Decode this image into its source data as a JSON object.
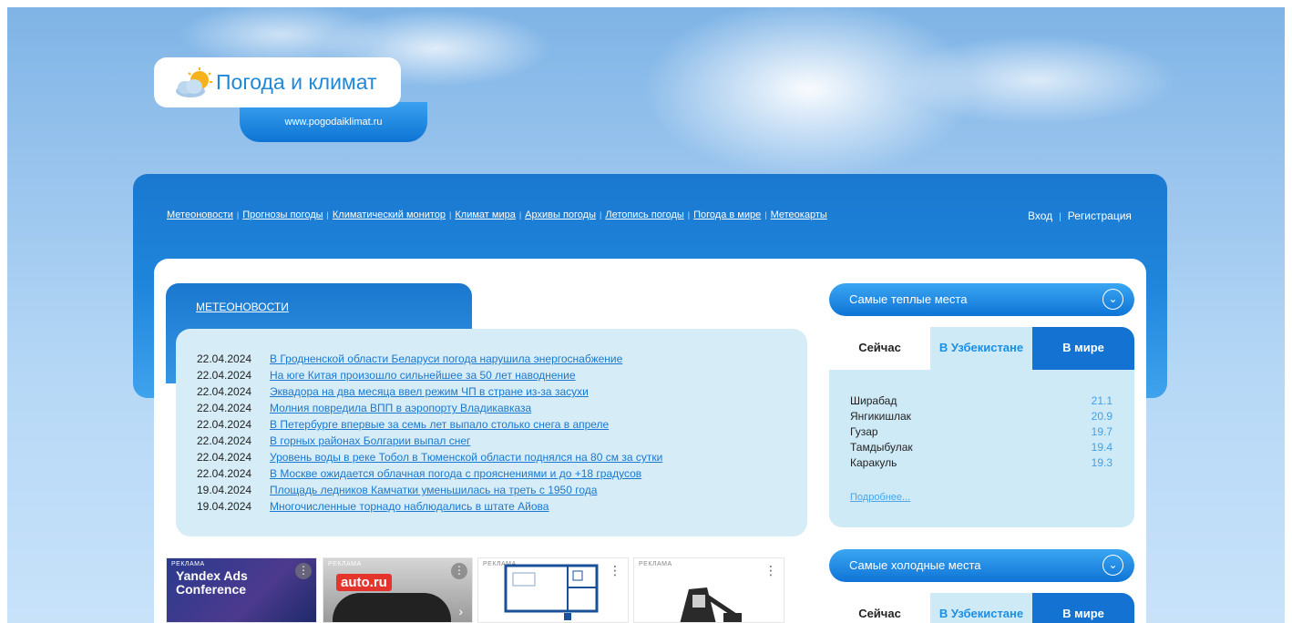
{
  "header": {
    "site_title": "Погода и климат",
    "site_url": "www.pogodaiklimat.ru"
  },
  "nav": {
    "items": [
      {
        "label": "Метеоновости"
      },
      {
        "label": "Прогнозы погоды"
      },
      {
        "label": "Климатический монитор"
      },
      {
        "label": "Климат мира"
      },
      {
        "label": "Архивы погоды"
      },
      {
        "label": "Летопись погоды"
      },
      {
        "label": "Погода в мире"
      },
      {
        "label": "Метеокарты"
      }
    ],
    "login": "Вход",
    "register": "Регистрация"
  },
  "news": {
    "tab_label": "МЕТЕОНОВОСТИ",
    "items": [
      {
        "date": "22.04.2024",
        "title": "В Гродненской области Беларуси погода нарушила энергоснабжение"
      },
      {
        "date": "22.04.2024",
        "title": "На юге Китая произошло сильнейшее за 50 лет наводнение"
      },
      {
        "date": "22.04.2024",
        "title": "Эквадора на два месяца ввел режим ЧП в стране из-за засухи"
      },
      {
        "date": "22.04.2024",
        "title": "Молния повредила ВПП в аэропорту Владикавказа"
      },
      {
        "date": "22.04.2024",
        "title": "В Петербурге впервые за семь лет выпало столько снега в апреле"
      },
      {
        "date": "22.04.2024",
        "title": "В горных районах Болгарии выпал снег"
      },
      {
        "date": "22.04.2024",
        "title": "Уровень воды в реке Тобол в Тюменской области поднялся на 80 см за сутки"
      },
      {
        "date": "22.04.2024",
        "title": "В Москве ожидается облачная погода с прояснениями и до +18 градусов"
      },
      {
        "date": "19.04.2024",
        "title": "Площадь ледников Камчатки уменьшилась на треть с 1950 года"
      },
      {
        "date": "19.04.2024",
        "title": "Многочисленные торнадо наблюдались в штате Айова"
      }
    ]
  },
  "ads": {
    "label": "РЕКЛАМА",
    "ad1_text": "Yandex Ads Conference",
    "ad2_logo": "auto.ru"
  },
  "warmest": {
    "title": "Самые теплые места",
    "tabs": {
      "now": "Сейчас",
      "uz": "В Узбекистане",
      "world": "В мире"
    },
    "cities": [
      {
        "name": "Ширабад",
        "value": "21.1"
      },
      {
        "name": "Янгикишлак",
        "value": "20.9"
      },
      {
        "name": "Гузар",
        "value": "19.7"
      },
      {
        "name": "Тамдыбулак",
        "value": "19.4"
      },
      {
        "name": "Каракуль",
        "value": "19.3"
      }
    ],
    "more": "Подробнее..."
  },
  "coldest": {
    "title": "Самые холодные места",
    "tabs": {
      "now": "Сейчас",
      "uz": "В Узбекистане",
      "world": "В мире"
    }
  },
  "colors": {
    "accent": "#1a78cf",
    "news_bg": "#d6edf8",
    "value_color": "#3fa0e8"
  }
}
